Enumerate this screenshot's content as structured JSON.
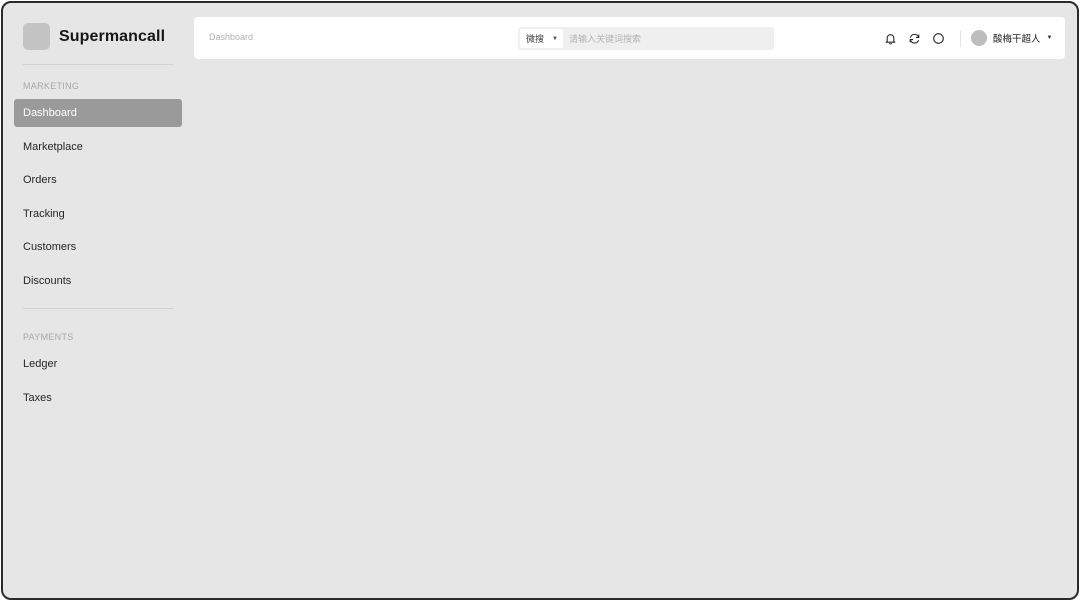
{
  "brand": {
    "name": "Supermancall",
    "logo_icon": "logo-square-icon"
  },
  "sidebar": {
    "sections": [
      {
        "label": "MARKETING",
        "items": [
          {
            "label": "Dashboard",
            "active": true
          },
          {
            "label": "Marketplace",
            "active": false
          },
          {
            "label": "Orders",
            "active": false
          },
          {
            "label": "Tracking",
            "active": false
          },
          {
            "label": "Customers",
            "active": false
          },
          {
            "label": "Discounts",
            "active": false
          }
        ]
      },
      {
        "label": "PAYMENTS",
        "items": [
          {
            "label": "Ledger",
            "active": false
          },
          {
            "label": "Taxes",
            "active": false
          }
        ]
      }
    ]
  },
  "header": {
    "breadcrumb": "Dashboard",
    "search": {
      "type_selected": "微搜",
      "placeholder": "请输入关键词搜索"
    },
    "icons": [
      "bell-icon",
      "refresh-icon",
      "circle-icon"
    ],
    "user": {
      "name": "酸梅干超人"
    }
  },
  "colors": {
    "background": "#e6e6e6",
    "active_nav": "#9a9a9a",
    "header": "#ffffff"
  }
}
